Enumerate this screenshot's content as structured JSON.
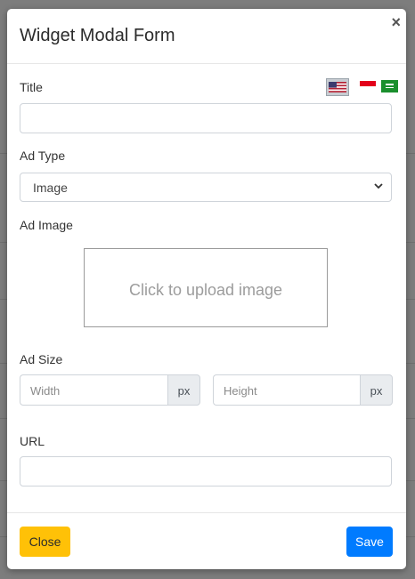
{
  "modal": {
    "title": "Widget Modal Form",
    "close_symbol": "×"
  },
  "language_flags": [
    {
      "icon": "us-flag-icon",
      "selected": true
    },
    {
      "icon": "indonesia-flag-icon",
      "selected": false
    },
    {
      "icon": "saudi-arabia-flag-icon",
      "selected": false
    }
  ],
  "form": {
    "title_label": "Title",
    "title_value": "",
    "ad_type_label": "Ad Type",
    "ad_type_value": "Image",
    "ad_image_label": "Ad Image",
    "upload_text": "Click to upload image",
    "ad_size_label": "Ad Size",
    "width_placeholder": "Width",
    "height_placeholder": "Height",
    "unit": "px",
    "url_label": "URL",
    "url_value": ""
  },
  "footer": {
    "close_label": "Close",
    "save_label": "Save"
  },
  "colors": {
    "close_button": "#ffc107",
    "save_button": "#007bff",
    "backdrop": "#7d7d7d"
  }
}
